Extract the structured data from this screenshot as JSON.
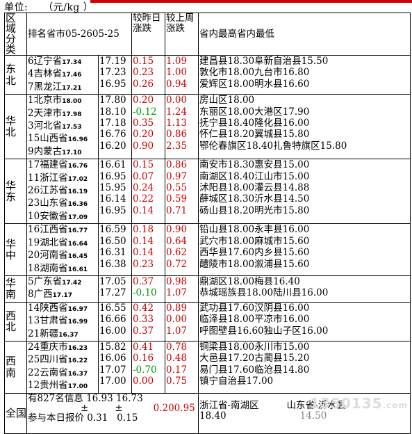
{
  "unit_label": "单位:",
  "unit_value": "（元/kg ）",
  "header": {
    "region": "区域\n分类",
    "rank_market": "排名省市05-2605-25",
    "col1": "",
    "daily_change": "较昨日\n涨跌",
    "weekly_change": "较上周\n涨跌",
    "high_low": "省内最高省内最低"
  },
  "groups": [
    {
      "region": "东北",
      "rows": [
        {
          "rank": "6",
          "province": "辽宁省",
          "prev": "17.34",
          "price": "17.19",
          "d": "0.15",
          "w": "1.09",
          "high": "建昌县18.30",
          "low": "阜新自治县15.50"
        },
        {
          "rank": "4",
          "province": "吉林省",
          "prev": "17.46",
          "price": "17.23",
          "d": "0.23",
          "w": "1.00",
          "high": "敦化市18.00",
          "low": "九台市16.80"
        },
        {
          "rank": "7",
          "province": "黑龙江",
          "prev": "17.21",
          "price": "16.95",
          "d": "0.26",
          "w": "0.94",
          "high": "爱辉区18.00",
          "low": "明水县16.60"
        }
      ]
    },
    {
      "region": "华北",
      "rows": [
        {
          "rank": "1",
          "province": "北京市",
          "prev": "18.00",
          "price": "17.80",
          "d": "0.20",
          "w": "0.00",
          "high": "房山区18.00",
          "low": ""
        },
        {
          "rank": "2",
          "province": "天津市",
          "prev": "17.98",
          "price": "18.10",
          "d": "-0.12",
          "w": "1.24",
          "high": "东丽区18.00",
          "low": "大港区17.90"
        },
        {
          "rank": "3",
          "province": "河北省",
          "prev": "17.53",
          "price": "17.18",
          "d": "0.35",
          "w": "1.13",
          "high": "抚宁县18.40",
          "low": "隆化县16.00"
        },
        {
          "rank": "15",
          "province": "山西省",
          "prev": "16.96",
          "price": "16.76",
          "d": "0.20",
          "w": "0.86",
          "high": "怀仁县18.20",
          "low": "翼城县15.80"
        },
        {
          "rank": "9",
          "province": "内蒙古",
          "prev": "17.10",
          "price": "16.20",
          "d": "0.90",
          "w": "2.35",
          "high": "鄂伦春旗区18.40",
          "low": "扎鲁特旗区15.80"
        }
      ]
    },
    {
      "region": "华东",
      "rows": [
        {
          "rank": "17",
          "province": "福建省",
          "prev": "16.76",
          "price": "16.61",
          "d": "0.15",
          "w": "0.86",
          "high": "南安市18.30",
          "low": "惠安县15.00"
        },
        {
          "rank": "11",
          "province": "浙江省",
          "prev": "17.02",
          "price": "16.95",
          "d": "0.07",
          "w": "0.97",
          "high": "南湖区18.40",
          "low": "江山市15.00"
        },
        {
          "rank": "26",
          "province": "江苏省",
          "prev": "16.19",
          "price": "15.95",
          "d": "0.24",
          "w": "0.55",
          "high": "沭阳县18.00",
          "low": "灌云县14.88"
        },
        {
          "rank": "23",
          "province": "山东省",
          "prev": "16.36",
          "price": "16.14",
          "d": "0.22",
          "w": "0.59",
          "high": "薛城区18.30",
          "low": "沂水县14.50"
        },
        {
          "rank": "10",
          "province": "安徽省",
          "prev": "17.09",
          "price": "16.95",
          "d": "0.14",
          "w": "0.71",
          "high": "砀山县18.20",
          "low": "明光市15.80"
        }
      ]
    },
    {
      "region": "华中",
      "rows": [
        {
          "rank": "16",
          "province": "江西省",
          "prev": "16.77",
          "price": "16.59",
          "d": "0.18",
          "w": "0.90",
          "high": "铅山县18.00",
          "low": "永丰县16.00"
        },
        {
          "rank": "19",
          "province": "湖北省",
          "prev": "16.64",
          "price": "16.50",
          "d": "0.14",
          "w": "0.64",
          "high": "武穴市18.00",
          "low": "麻城市15.60"
        },
        {
          "rank": "20",
          "province": "河南省",
          "prev": "16.45",
          "price": "16.31",
          "d": "0.14",
          "w": "0.62",
          "high": "西华县17.60",
          "low": "内乡县15.60"
        },
        {
          "rank": "18",
          "province": "湖南省",
          "prev": "16.61",
          "price": "16.38",
          "d": "0.23",
          "w": "0.72",
          "high": "醴陵市18.00",
          "low": "溆浦县15.60"
        }
      ]
    },
    {
      "region": "华南",
      "rows": [
        {
          "rank": "5",
          "province": "广东省",
          "prev": "17.42",
          "price": "17.05",
          "d": "0.37",
          "w": "0.98",
          "high": "鼎湖区18.00",
          "low": "梅县16.40"
        },
        {
          "rank": "8",
          "province": "广西",
          "prev": "17.17",
          "price": "17.27",
          "d": "-0.10",
          "w": "1.07",
          "high": "恭城瑶族县18.00",
          "low": "陆川县16.00"
        }
      ]
    },
    {
      "region": "西北",
      "rows": [
        {
          "rank": "14",
          "province": "陕西省",
          "prev": "16.97",
          "price": "16.55",
          "d": "0.42",
          "w": "0.89",
          "high": "武功县17.60",
          "low": "汉阴县16.00"
        },
        {
          "rank": "13",
          "province": "甘肃省",
          "prev": "16.99",
          "price": "16.66",
          "d": "0.33",
          "w": "0.00",
          "high": "临泽县18.00",
          "low": "平凉市16.00"
        },
        {
          "rank": "21",
          "province": "新疆",
          "prev": "16.37",
          "price": "16.00",
          "d": "0.37",
          "w": "1.07",
          "high": "呼图壁县16.60",
          "low": "独山子区16.00"
        }
      ]
    },
    {
      "region": "西南",
      "rows": [
        {
          "rank": "24",
          "province": "重庆市",
          "prev": "16.23",
          "price": "15.82",
          "d": "0.41",
          "w": "0.78",
          "high": "铜梁县18.00",
          "low": "永川市15.00"
        },
        {
          "rank": "25",
          "province": "四川省",
          "prev": "16.22",
          "price": "16.06",
          "d": "0.16",
          "w": "0.48",
          "high": "大邑县17.20",
          "low": "古蔺县15.20"
        },
        {
          "rank": "22",
          "province": "云南省",
          "prev": "16.37",
          "price": "17.07",
          "d": "-0.70",
          "w": "0.17",
          "high": "易门县17.60",
          "low": "临沧县14.80"
        },
        {
          "rank": "12",
          "province": "贵州省",
          "prev": "17.00",
          "price": "17.00",
          "d": "0.00",
          "w": "0.75",
          "high": "镇宁自治县17.00",
          "low": ""
        }
      ]
    }
  ],
  "national": {
    "region": "全国均",
    "line1": "有827名信息",
    "line2": "参与本日报价",
    "avg_prev": "16.93",
    "avg_price": "16.73",
    "pm": "±",
    "d": "0.31",
    "w": "0.15",
    "w_pm": "0.200.95",
    "high": "浙江省-南湖区",
    "high_val": "18.40",
    "low": "山东省-沂水县",
    "low_val": "14.50"
  },
  "watermark": "1350135",
  "watermark_suffix": ".com",
  "colors": {
    "up": "#cc0000",
    "down": "#009900",
    "accent_bar": "#cc0000"
  }
}
